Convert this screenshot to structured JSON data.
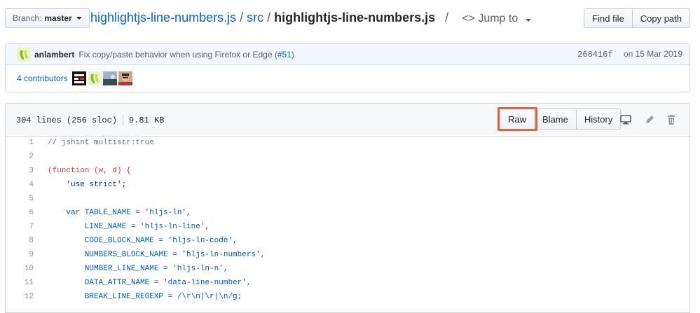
{
  "branch": {
    "label": "Branch:",
    "value": "master"
  },
  "breadcrumb": {
    "repo": "highlightjs-line-numbers.js",
    "sep": "/",
    "folder": "src",
    "file": "highlightjs-line-numbers.js",
    "sep2": "/",
    "jump_label": "Jump to"
  },
  "top_buttons": {
    "find_file": "Find file",
    "copy_path": "Copy path"
  },
  "commit": {
    "author": "anlambert",
    "message": "Fix copy/paste behavior when using Firefox or Edge (",
    "pr_link": "#51",
    "message_end": ")",
    "sha": "268416f",
    "date": "on 15 Mar 2019"
  },
  "contributors": {
    "label": "4 contributors"
  },
  "file": {
    "lines": "304 lines (256 sloc)",
    "size": "9.81 KB"
  },
  "file_buttons": {
    "raw": "Raw",
    "blame": "Blame",
    "history": "History"
  },
  "code_lines": [
    {
      "n": "1",
      "t": "// jshint multistr:true"
    },
    {
      "n": "2",
      "t": ""
    },
    {
      "n": "3",
      "t": "(function (w, d) {"
    },
    {
      "n": "4",
      "t": "    'use strict';"
    },
    {
      "n": "5",
      "t": ""
    },
    {
      "n": "6",
      "t": "    var TABLE_NAME = 'hljs-ln',"
    },
    {
      "n": "7",
      "t": "        LINE_NAME = 'hljs-ln-line',"
    },
    {
      "n": "8",
      "t": "        CODE_BLOCK_NAME = 'hljs-ln-code',"
    },
    {
      "n": "9",
      "t": "        NUMBERS_BLOCK_NAME = 'hljs-ln-numbers',"
    },
    {
      "n": "10",
      "t": "        NUMBER_LINE_NAME = 'hljs-ln-n',"
    },
    {
      "n": "11",
      "t": "        DATA_ATTR_NAME = 'data-line-number',"
    },
    {
      "n": "12",
      "t": "        BREAK_LINE_REGEXP = /\\r\\n|\\r|\\n/g;"
    }
  ],
  "icons": [
    "desktop-icon",
    "pencil-icon",
    "trash-icon"
  ],
  "colors": {
    "link": "#0366d6",
    "highlight": "#e0623f",
    "commit_bg": "#f1f8ff"
  }
}
